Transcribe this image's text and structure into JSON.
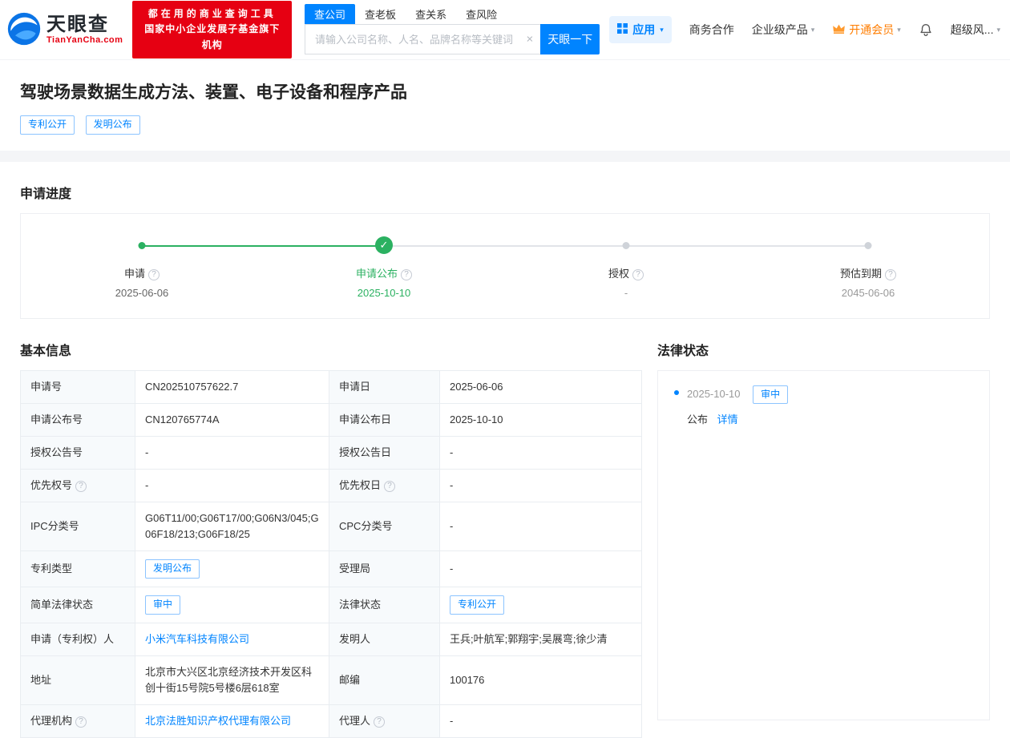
{
  "icons": {
    "help": "?",
    "check": "✓",
    "clear": "×",
    "caret": "▾",
    "bullet": "•"
  },
  "colors": {
    "brand_blue": "#0084ff",
    "success_green": "#2bb161",
    "promo_red": "#e60012",
    "vip_orange": "#ff7d00"
  },
  "header": {
    "logo": {
      "brand": "天眼查",
      "domain": "TianYanCha.com"
    },
    "promo": {
      "line1": "都在用的商业查询工具",
      "line2": "国家中小企业发展子基金旗下机构"
    },
    "search": {
      "tabs": [
        "查公司",
        "查老板",
        "查关系",
        "查风险"
      ],
      "placeholder": "请输入公司名称、人名、品牌名称等关键词",
      "button": "天眼一下"
    },
    "nav": {
      "apps": "应用",
      "cooperation": "商务合作",
      "enterprise": "企业级产品",
      "vip": "开通会员",
      "super": "超级风..."
    }
  },
  "patent": {
    "title": "驾驶场景数据生成方法、装置、电子设备和程序产品",
    "tags": [
      "专利公开",
      "发明公布"
    ]
  },
  "progress": {
    "heading": "申请进度",
    "steps": [
      {
        "label": "申请",
        "date": "2025-06-06"
      },
      {
        "label": "申请公布",
        "date": "2025-10-10"
      },
      {
        "label": "授权",
        "date": "-"
      },
      {
        "label": "预估到期",
        "date": "2045-06-06"
      }
    ]
  },
  "basic_info": {
    "heading": "基本信息",
    "rows": [
      {
        "label1": "申请号",
        "value1": "CN202510757622.7",
        "label2": "申请日",
        "value2": "2025-06-06"
      },
      {
        "label1": "申请公布号",
        "value1": "CN120765774A",
        "label2": "申请公布日",
        "value2": "2025-10-10"
      },
      {
        "label1": "授权公告号",
        "value1": "-",
        "label2": "授权公告日",
        "value2": "-"
      },
      {
        "label1": "优先权号",
        "value1": "-",
        "label2": "优先权日",
        "value2": "-"
      },
      {
        "label1": "IPC分类号",
        "value1": "G06T11/00;G06T17/00;G06N3/045;G06F18/213;G06F18/25",
        "label2": "CPC分类号",
        "value2": "-"
      },
      {
        "label1": "专利类型",
        "value1": "发明公布",
        "label2": "受理局",
        "value2": "-"
      },
      {
        "label1": "简单法律状态",
        "value1": "审中",
        "label2": "法律状态",
        "value2": "专利公开"
      },
      {
        "label1": "申请（专利权）人",
        "value1": "小米汽车科技有限公司",
        "label2": "发明人",
        "value2": "王兵;叶航军;郭翔宇;吴展弯;徐少清"
      },
      {
        "label1": "地址",
        "value1": "北京市大兴区北京经济技术开发区科创十街15号院5号楼6层618室",
        "label2": "邮编",
        "value2": "100176"
      },
      {
        "label1": "代理机构",
        "value1": "北京法胜知识产权代理有限公司",
        "label2": "代理人",
        "value2": "-"
      }
    ]
  },
  "legal": {
    "heading": "法律状态",
    "items": [
      {
        "date": "2025-10-10",
        "tag": "审中",
        "action": "公布",
        "link": "详情"
      }
    ]
  }
}
